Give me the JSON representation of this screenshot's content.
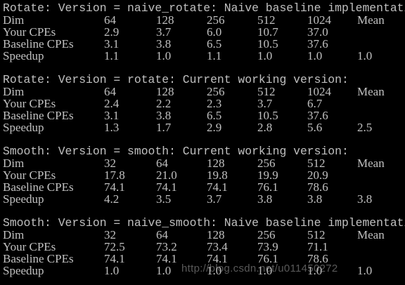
{
  "blocks": [
    {
      "title": "Rotate: Version = naive_rotate: Naive baseline implementation:",
      "rows": [
        {
          "label": "Dim",
          "cells": [
            "64",
            "128",
            "256",
            "512",
            "1024",
            "Mean"
          ]
        },
        {
          "label": "Your CPEs",
          "cells": [
            "2.9",
            "3.7",
            "6.0",
            "10.7",
            "37.0",
            ""
          ]
        },
        {
          "label": "Baseline CPEs",
          "cells": [
            "3.1",
            "3.8",
            "6.5",
            "10.5",
            "37.6",
            ""
          ]
        },
        {
          "label": "Speedup",
          "cells": [
            "1.1",
            "1.0",
            "1.1",
            "1.0",
            "1.0",
            "1.0"
          ]
        }
      ]
    },
    {
      "title": "Rotate: Version = rotate: Current working version:",
      "rows": [
        {
          "label": "Dim",
          "cells": [
            "64",
            "128",
            "256",
            "512",
            "1024",
            "Mean"
          ]
        },
        {
          "label": "Your CPEs",
          "cells": [
            "2.4",
            "2.2",
            "2.3",
            "3.7",
            "6.7",
            ""
          ]
        },
        {
          "label": "Baseline CPEs",
          "cells": [
            "3.1",
            "3.8",
            "6.5",
            "10.5",
            "37.6",
            ""
          ]
        },
        {
          "label": "Speedup",
          "cells": [
            "1.3",
            "1.7",
            "2.9",
            "2.8",
            "5.6",
            "2.5"
          ]
        }
      ]
    },
    {
      "title": "Smooth: Version = smooth: Current working version:",
      "rows": [
        {
          "label": "Dim",
          "cells": [
            "32",
            "64",
            "128",
            "256",
            "512",
            "Mean"
          ]
        },
        {
          "label": "Your CPEs",
          "cells": [
            "17.8",
            "21.0",
            "19.8",
            "19.9",
            "20.9",
            ""
          ]
        },
        {
          "label": "Baseline CPEs",
          "cells": [
            "74.1",
            "74.1",
            "74.1",
            "76.1",
            "78.6",
            ""
          ]
        },
        {
          "label": "Speedup",
          "cells": [
            "4.2",
            "3.5",
            "3.7",
            "3.8",
            "3.8",
            "3.8"
          ]
        }
      ]
    },
    {
      "title": "Smooth: Version = naive_smooth: Naive baseline implementation:",
      "rows": [
        {
          "label": "Dim",
          "cells": [
            "32",
            "64",
            "128",
            "256",
            "512",
            "Mean"
          ]
        },
        {
          "label": "Your CPEs",
          "cells": [
            "72.5",
            "73.2",
            "73.4",
            "73.9",
            "71.1",
            ""
          ]
        },
        {
          "label": "Baseline CPEs",
          "cells": [
            "74.1",
            "74.1",
            "74.1",
            "76.1",
            "78.6",
            ""
          ]
        },
        {
          "label": "Speedup",
          "cells": [
            "1.0",
            "1.0",
            "1.0",
            "1.0",
            "1.0",
            "1.0"
          ]
        }
      ]
    }
  ],
  "watermark": "http://blog.csdn.net/u011450272",
  "colors": {
    "background": "#000000",
    "text": "#c0c0c0"
  }
}
